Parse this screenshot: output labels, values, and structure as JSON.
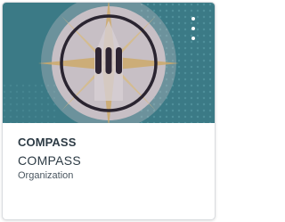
{
  "card": {
    "short_name": "COMPASS",
    "full_name": "COMPASS",
    "term": "Organization",
    "hero_color": "#3b7a86",
    "icons": {
      "menu": "vertical-ellipsis-icon",
      "logo": "compass-logo"
    }
  }
}
